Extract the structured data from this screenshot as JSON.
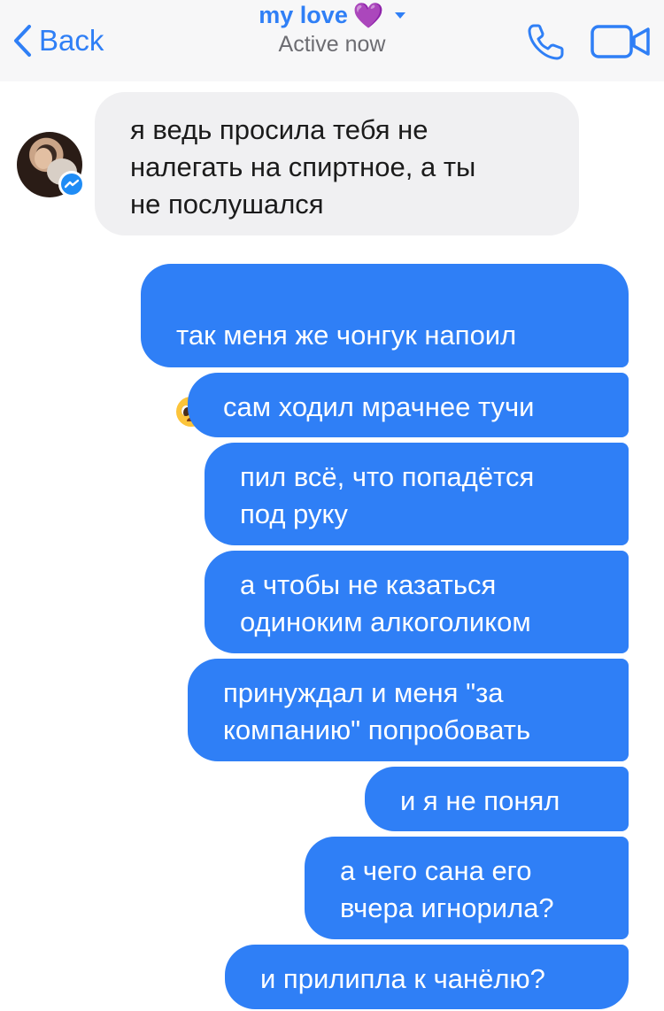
{
  "header": {
    "back_label": "Back",
    "contact_name": "my love",
    "heart": "💜",
    "status": "Active now",
    "icons": [
      "chevron-left-icon",
      "chevron-down-icon",
      "phone-icon",
      "video-camera-icon"
    ]
  },
  "colors": {
    "accent": "#2f7ff6",
    "incoming_bubble": "#f0f0f2",
    "outgoing_bubble": "#2f7ff6",
    "header_bg": "#f7f7f8"
  },
  "messages": [
    {
      "from": "contact",
      "text": "я ведь просила тебя не\nналегать на спиртное, а ты\nне послушался"
    },
    {
      "from": "me",
      "text": "так меня же чонгук напоил",
      "emoji": "pleading-face"
    },
    {
      "from": "me",
      "text": "сам ходил мрачнее тучи"
    },
    {
      "from": "me",
      "text": "пил всё, что попадётся\nпод руку"
    },
    {
      "from": "me",
      "text": "а чтобы не казаться\nодиноким алкоголиком"
    },
    {
      "from": "me",
      "text": "принуждал и меня \"за\nкомпанию\" попробовать"
    },
    {
      "from": "me",
      "text": "и я не понял"
    },
    {
      "from": "me",
      "text": "а чего сана его\nвчера игнорила?"
    },
    {
      "from": "me",
      "text": "и прилипла к чанёлю?"
    }
  ]
}
